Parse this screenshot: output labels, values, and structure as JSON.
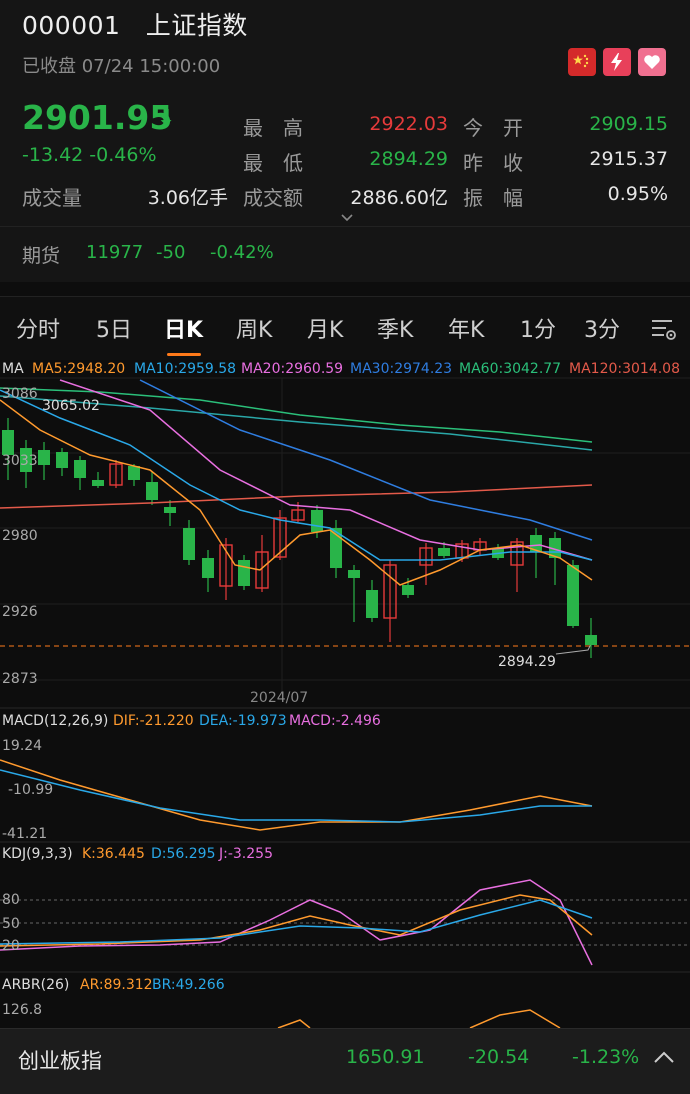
{
  "header": {
    "code": "000001",
    "name": "上证指数",
    "status": "已收盘 07/24 15:00:00",
    "price": "2901.95",
    "change": "-13.42",
    "change_pct": "-0.46%",
    "stats": {
      "high_label": "最　高",
      "high": "2922.03",
      "open_label": "今　开",
      "open": "2909.15",
      "low_label": "最　低",
      "low": "2894.29",
      "prev_label": "昨　收",
      "prev": "2915.37",
      "volume_label": "成交量",
      "volume": "3.06亿手",
      "amount_label": "成交额",
      "amount": "2886.60亿",
      "amp_label": "振　幅",
      "amp": "0.95%"
    },
    "futures": {
      "label": "期货",
      "value": "11977",
      "change": "-50",
      "pct": "-0.42%"
    }
  },
  "tabs": [
    "分时",
    "5日",
    "日K",
    "周K",
    "月K",
    "季K",
    "年K",
    "1分",
    "3分"
  ],
  "active_tab": "日K",
  "ma_line": {
    "label": "MA",
    "items": [
      {
        "text": "MA5:2948.20",
        "color": "#ff9a2e"
      },
      {
        "text": "MA10:2959.58",
        "color": "#2aa8e8"
      },
      {
        "text": "MA20:2960.59",
        "color": "#e86fe0"
      },
      {
        "text": "MA30:2974.23",
        "color": "#2f7de0"
      },
      {
        "text": "MA60:3042.77",
        "color": "#2bbf7a"
      },
      {
        "text": "MA120:3014.08",
        "color": "#e35a4a"
      }
    ]
  },
  "kline": {
    "y_labels": [
      "3086",
      "3033",
      "2980",
      "2926",
      "2873"
    ],
    "peak_label": "3065.02",
    "low_label": "2894.29",
    "date_label": "2024/07"
  },
  "macd": {
    "label": "MACD(12,26,9)",
    "dif": "DIF:-21.220",
    "dea": "DEA:-19.973",
    "macd": "MACD:-2.496",
    "y_labels": [
      "19.24",
      "-10.99",
      "-41.21"
    ]
  },
  "kdj": {
    "label": "KDJ(9,3,3)",
    "k": "K:36.445",
    "d": "D:56.295",
    "j": "J:-3.255",
    "y_labels": [
      "80",
      "50",
      "20"
    ]
  },
  "arbr": {
    "label": "ARBR(26)",
    "ar": "AR:89.312",
    "br": "BR:49.266",
    "y_labels": [
      "126.8"
    ]
  },
  "bottom": {
    "name": "创业板指",
    "price": "1650.91",
    "change": "-20.54",
    "pct": "-1.23%"
  },
  "colors": {
    "up": "#e63b3b",
    "down": "#29b449",
    "accent": "#ff7a1a"
  }
}
